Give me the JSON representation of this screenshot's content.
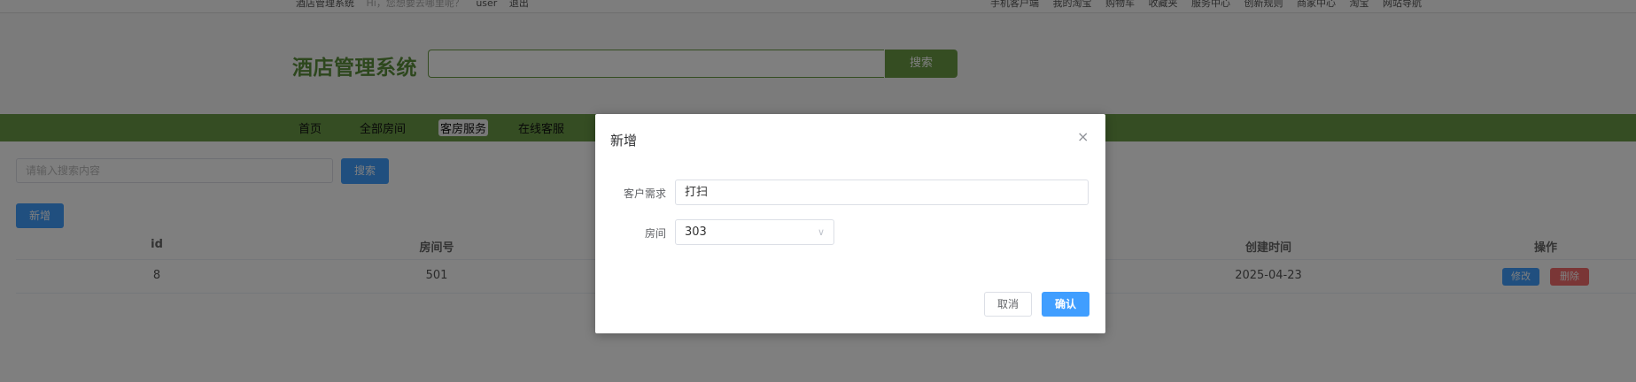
{
  "topbar": {
    "left": [
      "酒店管理系统",
      "Hi，您想要去哪里呢？",
      "user",
      "退出"
    ],
    "right": [
      "手机客户端",
      "我的淘宝",
      "购物车",
      "收藏夹",
      "服务中心",
      "创新规则",
      "商家中心",
      "淘宝",
      "网站导航"
    ]
  },
  "header": {
    "logo": "酒店管理系统",
    "search_button": "搜索"
  },
  "nav": {
    "items": [
      "首页",
      "全部房间",
      "客房服务",
      "在线客服"
    ]
  },
  "content": {
    "search_placeholder": "请输入搜索内容",
    "search_button": "搜索",
    "add_button": "新增",
    "columns": [
      "id",
      "房间号",
      "创建时间",
      "操作"
    ],
    "rows": [
      {
        "id": "8",
        "room": "501",
        "created": "2025-04-23",
        "edit": "修改",
        "delete": "删除"
      }
    ]
  },
  "dialog": {
    "title": "新增",
    "close_icon": "×",
    "fields": {
      "requirement_label": "客户需求",
      "requirement_value": "打扫",
      "room_label": "房间",
      "room_value": "303"
    },
    "cancel": "取消",
    "confirm": "确认"
  }
}
